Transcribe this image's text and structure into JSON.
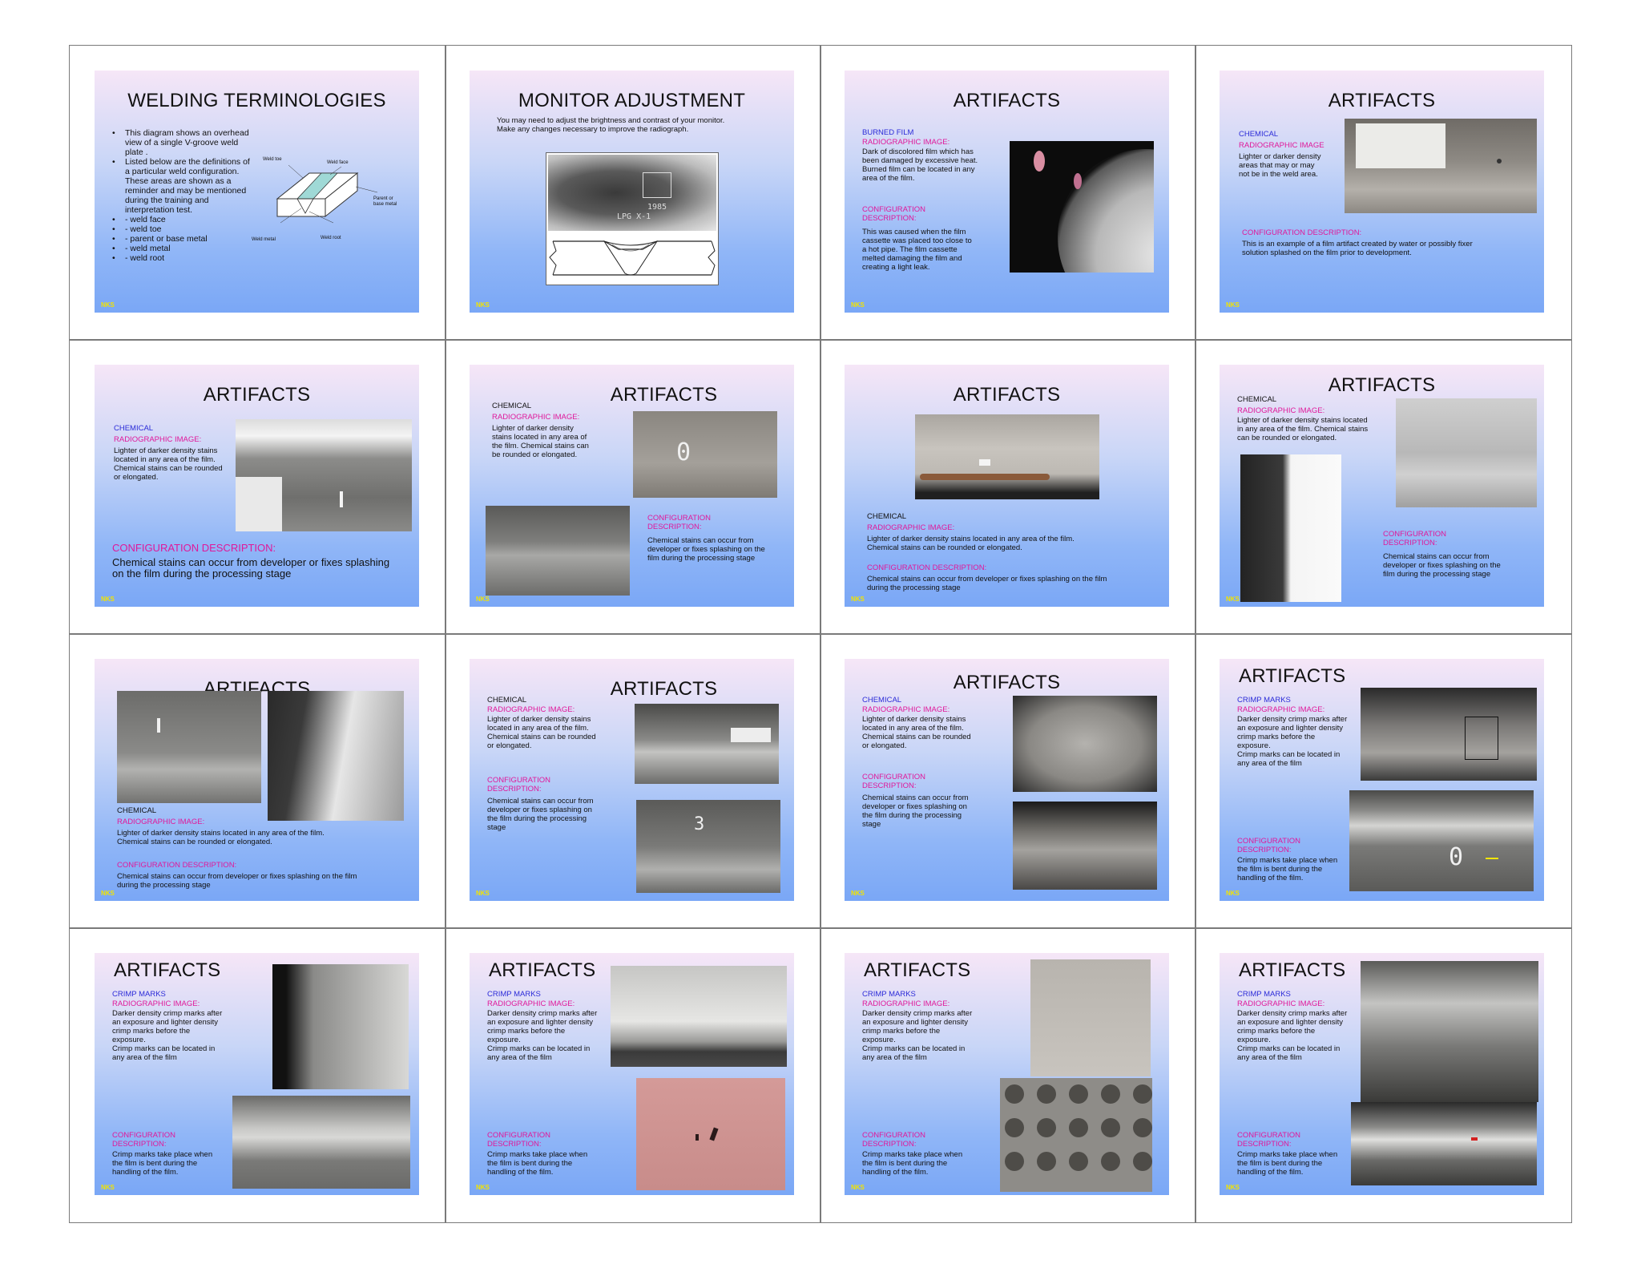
{
  "footer_label": "NKS",
  "slides": {
    "s1": {
      "title": "WELDING TERMINOLOGIES",
      "bullets": [
        "This diagram shows an overhead view of a single V-groove weld plate .",
        "Listed below are the definitions of a particular weld configuration. These areas are shown as a reminder and may be mentioned during the training and interpretation test.",
        "-     weld face",
        "-     weld toe",
        "-     parent or base metal",
        "-     weld metal",
        "-     weld root"
      ],
      "diagram_labels": {
        "weld_toe": "Weld toe",
        "weld_face": "Weld face",
        "parent": "Parent or",
        "base": "base metal",
        "weld_metal": "Weld metal",
        "weld_root": "Weld root"
      }
    },
    "s2": {
      "title": "MONITOR ADJUSTMENT",
      "text": "You may need to adjust the brightness and contrast of your monitor.\nMake any changes necessary to improve the radiograph.",
      "film_text_1": "1985",
      "film_text_2": "LPG X-1"
    },
    "s3": {
      "title": "ARTIFACTS",
      "heading": "BURNED FILM",
      "subheading": "RADIOGRAPHIC IMAGE:",
      "text": "Dark of discolored film which has\nbeen damaged by excessive heat.\nBurned film can be located in any\narea of the film.",
      "config_heading": "CONFIGURATION\nDESCRIPTION:",
      "config_text": "This was caused when the film\ncassette was placed too close to\na hot pipe. The film cassette\nmelted damaging the film and\ncreating a light leak."
    },
    "s4": {
      "title": "ARTIFACTS",
      "heading": "CHEMICAL",
      "subheading": "RADIOGRAPHIC IMAGE",
      "text": "Lighter or darker density\nareas that may or may\nnot be in the weld area.",
      "config_heading": "CONFIGURATION DESCRIPTION:",
      "config_text": "This is an example of a film artifact created by water or possibly fixer\nsolution splashed on the film prior to development."
    },
    "s5": {
      "title": "ARTIFACTS",
      "heading": "CHEMICAL",
      "subheading": "RADIOGRAPHIC IMAGE:",
      "text": "Lighter of darker density stains\nlocated in any area of the film.\nChemical stains can be rounded\nor elongated.",
      "config_heading": "CONFIGURATION DESCRIPTION:",
      "config_text": "Chemical stains can occur from developer or fixes splashing\non the film during the processing stage"
    },
    "s6": {
      "title": "ARTIFACTS",
      "heading": "CHEMICAL",
      "subheading": "RADIOGRAPHIC IMAGE:",
      "text": "Lighter of darker density\nstains located in any area of\nthe film. Chemical stains can\nbe rounded or elongated.",
      "config_heading": "CONFIGURATION\nDESCRIPTION:",
      "config_text": "Chemical stains can occur from\ndeveloper or fixes splashing on the\nfilm during the processing stage",
      "film_number": "0"
    },
    "s7": {
      "title": "ARTIFACTS",
      "heading": "CHEMICAL",
      "subheading": "RADIOGRAPHIC IMAGE:",
      "text": "Lighter of darker density stains located in any area of the film.\nChemical stains can be rounded or elongated.",
      "config_heading": "CONFIGURATION DESCRIPTION:",
      "config_text": "Chemical stains can occur from developer or fixes splashing on the film\nduring the processing stage"
    },
    "s8": {
      "title": "ARTIFACTS",
      "heading": "CHEMICAL",
      "subheading": "RADIOGRAPHIC IMAGE:",
      "text": "Lighter of darker density stains located\nin any area of the film. Chemical stains\ncan be rounded or elongated.",
      "config_heading": "CONFIGURATION\nDESCRIPTION:",
      "config_text": "Chemical stains can occur from\ndeveloper or fixes splashing on the\nfilm during the processing stage"
    },
    "s9": {
      "title": "ARTIFACTS",
      "heading": "CHEMICAL",
      "subheading": "RADIOGRAPHIC IMAGE:",
      "text": "Lighter of darker density stains located in any area of the film.\nChemical stains can be rounded or elongated.",
      "config_heading": "CONFIGURATION DESCRIPTION:",
      "config_text": "Chemical stains can occur from developer or fixes splashing on the film\nduring the processing stage"
    },
    "s10": {
      "title": "ARTIFACTS",
      "heading": "CHEMICAL",
      "subheading": "RADIOGRAPHIC IMAGE:",
      "text": "Lighter of darker density stains\nlocated in any area of the film.\nChemical stains can be rounded\nor elongated.",
      "config_heading": "CONFIGURATION\nDESCRIPTION:",
      "config_text": "Chemical stains can occur from\ndeveloper or fixes splashing on\nthe film during the processing\nstage",
      "film_number": "3"
    },
    "s11": {
      "title": "ARTIFACTS",
      "heading": "CHEMICAL",
      "subheading": "RADIOGRAPHIC IMAGE:",
      "text": "Lighter of darker density stains\nlocated in any area of the film.\nChemical stains can be rounded\nor elongated.",
      "config_heading": "CONFIGURATION\nDESCRIPTION:",
      "config_text": "Chemical stains can occur from\ndeveloper or fixes splashing on\nthe film during the processing\nstage"
    },
    "s12": {
      "title": "ARTIFACTS",
      "heading": "CRIMP MARKS",
      "subheading": "RADIOGRAPHIC IMAGE:",
      "text": "Darker density crimp marks after\nan exposure and lighter density\ncrimp marks before the\nexposure.\nCrimp marks can be located in\nany area of the film",
      "config_heading": "CONFIGURATION\nDESCRIPTION:",
      "config_text": "Crimp marks take place when\nthe film is bent during the\nhandling of the film.",
      "film_number": "0"
    },
    "s13": {
      "title": "ARTIFACTS",
      "heading": "CRIMP MARKS",
      "subheading": "RADIOGRAPHIC IMAGE:",
      "text": "Darker density crimp marks after\nan exposure and lighter density\ncrimp marks before the\nexposure.\nCrimp marks can be located in\nany area of the film",
      "config_heading": "CONFIGURATION\nDESCRIPTION:",
      "config_text": "Crimp marks take place when\nthe film is bent during the\nhandling of the film."
    },
    "s14": {
      "title": "ARTIFACTS",
      "heading": "CRIMP MARKS",
      "subheading": "RADIOGRAPHIC IMAGE:",
      "text": "Darker density crimp marks after\nan exposure and lighter density\ncrimp marks before the\nexposure.\nCrimp marks can be located in\nany area of the film",
      "config_heading": "CONFIGURATION\nDESCRIPTION:",
      "config_text": "Crimp marks take place when\nthe film is bent during the\nhandling of the film."
    },
    "s15": {
      "title": "ARTIFACTS",
      "heading": "CRIMP MARKS",
      "subheading": "RADIOGRAPHIC IMAGE:",
      "text": "Darker density crimp marks after\nan exposure and lighter density\ncrimp marks before the\nexposure.\nCrimp marks can be located in\nany area of the film",
      "config_heading": "CONFIGURATION\nDESCRIPTION:",
      "config_text": "Crimp marks take place when\nthe film is bent during the\nhandling of the film."
    },
    "s16": {
      "title": "ARTIFACTS",
      "heading": "CRIMP MARKS",
      "subheading": "RADIOGRAPHIC IMAGE:",
      "text": "Darker density crimp marks after\nan exposure and lighter density\ncrimp marks before the\nexposure.\nCrimp marks can be located in\nany area of the film",
      "config_heading": "CONFIGURATION\nDESCRIPTION:",
      "config_text": "Crimp marks take place when\nthe film is bent during the\nhandling of the film."
    }
  }
}
